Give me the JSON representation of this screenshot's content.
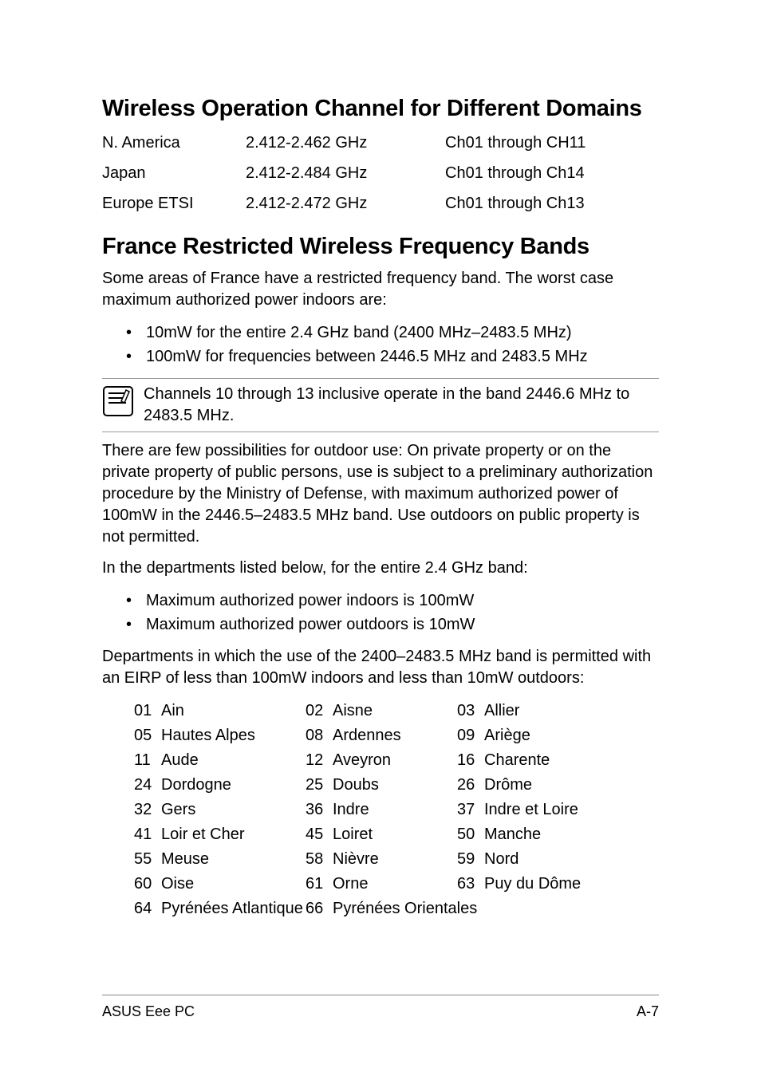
{
  "section1": {
    "title": "Wireless Operation Channel for Different Domains",
    "rows": [
      {
        "region": "N. America",
        "freq": "2.412-2.462 GHz",
        "channels": "Ch01 through CH11"
      },
      {
        "region": "Japan",
        "freq": "2.412-2.484 GHz",
        "channels": "Ch01 through Ch14"
      },
      {
        "region": "Europe ETSI",
        "freq": "2.412-2.472 GHz",
        "channels": "Ch01 through Ch13"
      }
    ]
  },
  "section2": {
    "title": "France Restricted Wireless Frequency Bands",
    "intro": "Some areas of France have a restricted frequency band. The worst case maximum authorized power indoors are:",
    "bullets1": [
      "10mW for the entire 2.4 GHz band (2400 MHz–2483.5 MHz)",
      "100mW for frequencies between 2446.5 MHz and 2483.5 MHz"
    ],
    "note": "Channels 10 through 13 inclusive operate in the band 2446.6 MHz to 2483.5 MHz.",
    "para2": "There are few possibilities for outdoor use: On private property or on the private property of public persons, use is subject to a preliminary authorization procedure by the Ministry of Defense, with maximum authorized power of 100mW in the 2446.5–2483.5 MHz band. Use outdoors on public property is not permitted.",
    "para3": "In the departments listed below, for the entire 2.4 GHz band:",
    "bullets2": [
      "Maximum authorized power indoors is 100mW",
      "Maximum authorized power outdoors is 10mW"
    ],
    "para4": "Departments in which the use of the 2400–2483.5 MHz band is permitted with an EIRP of less than 100mW indoors and less than 10mW outdoors:",
    "departments": [
      [
        {
          "n": "01",
          "name": "Ain"
        },
        {
          "n": "02",
          "name": "Aisne"
        },
        {
          "n": "03",
          "name": "Allier"
        }
      ],
      [
        {
          "n": "05",
          "name": "Hautes Alpes"
        },
        {
          "n": "08",
          "name": "Ardennes"
        },
        {
          "n": "09",
          "name": "Ariège"
        }
      ],
      [
        {
          "n": "11",
          "name": "Aude"
        },
        {
          "n": "12",
          "name": "Aveyron"
        },
        {
          "n": "16",
          "name": "Charente"
        }
      ],
      [
        {
          "n": "24",
          "name": "Dordogne"
        },
        {
          "n": "25",
          "name": "Doubs"
        },
        {
          "n": "26",
          "name": "Drôme"
        }
      ],
      [
        {
          "n": "32",
          "name": "Gers"
        },
        {
          "n": "36",
          "name": "Indre"
        },
        {
          "n": "37",
          "name": "Indre et Loire"
        }
      ],
      [
        {
          "n": "41",
          "name": "Loir et Cher"
        },
        {
          "n": "45",
          "name": "Loiret"
        },
        {
          "n": "50",
          "name": "Manche"
        }
      ],
      [
        {
          "n": "55",
          "name": "Meuse"
        },
        {
          "n": "58",
          "name": "Nièvre"
        },
        {
          "n": "59",
          "name": "Nord"
        }
      ],
      [
        {
          "n": "60",
          "name": "Oise"
        },
        {
          "n": "61",
          "name": "Orne"
        },
        {
          "n": "63",
          "name": "Puy du Dôme"
        }
      ],
      [
        {
          "n": "64",
          "name": "Pyrénées Atlantique"
        },
        {
          "n": "66",
          "name": "Pyrénées Orientales"
        }
      ]
    ]
  },
  "footer": {
    "left": "ASUS Eee PC",
    "right": "A-7"
  }
}
